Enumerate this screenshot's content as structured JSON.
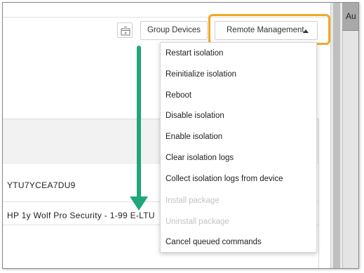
{
  "toolbar": {
    "add_icon": "add-to-group-icon",
    "group_devices_label": "Group Devices",
    "remote_management_label": "Remote Management",
    "highlight_color": "#f0a823"
  },
  "menu": {
    "items": [
      {
        "label": "Restart isolation",
        "enabled": true
      },
      {
        "label": "Reinitialize isolation",
        "enabled": true
      },
      {
        "label": "Reboot",
        "enabled": true
      },
      {
        "label": "Disable isolation",
        "enabled": true
      },
      {
        "label": "Enable isolation",
        "enabled": true
      },
      {
        "label": "Clear isolation logs",
        "enabled": true
      },
      {
        "label": "Collect isolation logs from device",
        "enabled": true
      },
      {
        "label": "Install package",
        "enabled": false
      },
      {
        "label": "Uninstall package",
        "enabled": false
      },
      {
        "label": "Cancel queued commands",
        "enabled": true
      }
    ]
  },
  "table": {
    "rows": [
      {
        "text": "YTU7YCEA7DU9"
      },
      {
        "text": "HP 1y Wolf Pro Security - 1-99 E-LTU"
      }
    ]
  },
  "right_pane": {
    "label": "Au"
  },
  "annotation": {
    "arrow_color": "#1fa67a"
  }
}
